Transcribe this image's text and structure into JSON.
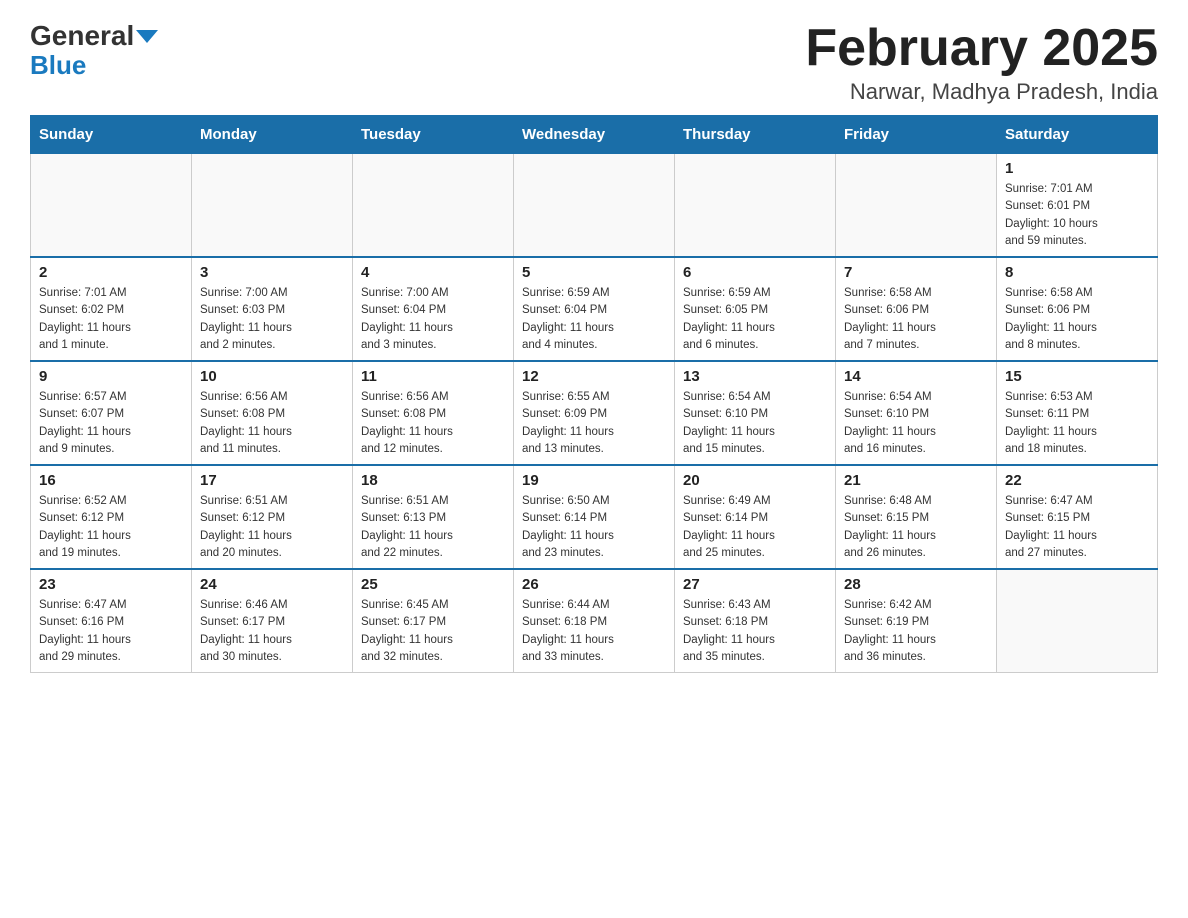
{
  "header": {
    "logo_general": "General",
    "logo_blue": "Blue",
    "title": "February 2025",
    "subtitle": "Narwar, Madhya Pradesh, India"
  },
  "weekdays": [
    "Sunday",
    "Monday",
    "Tuesday",
    "Wednesday",
    "Thursday",
    "Friday",
    "Saturday"
  ],
  "weeks": [
    [
      {
        "day": "",
        "info": ""
      },
      {
        "day": "",
        "info": ""
      },
      {
        "day": "",
        "info": ""
      },
      {
        "day": "",
        "info": ""
      },
      {
        "day": "",
        "info": ""
      },
      {
        "day": "",
        "info": ""
      },
      {
        "day": "1",
        "info": "Sunrise: 7:01 AM\nSunset: 6:01 PM\nDaylight: 10 hours\nand 59 minutes."
      }
    ],
    [
      {
        "day": "2",
        "info": "Sunrise: 7:01 AM\nSunset: 6:02 PM\nDaylight: 11 hours\nand 1 minute."
      },
      {
        "day": "3",
        "info": "Sunrise: 7:00 AM\nSunset: 6:03 PM\nDaylight: 11 hours\nand 2 minutes."
      },
      {
        "day": "4",
        "info": "Sunrise: 7:00 AM\nSunset: 6:04 PM\nDaylight: 11 hours\nand 3 minutes."
      },
      {
        "day": "5",
        "info": "Sunrise: 6:59 AM\nSunset: 6:04 PM\nDaylight: 11 hours\nand 4 minutes."
      },
      {
        "day": "6",
        "info": "Sunrise: 6:59 AM\nSunset: 6:05 PM\nDaylight: 11 hours\nand 6 minutes."
      },
      {
        "day": "7",
        "info": "Sunrise: 6:58 AM\nSunset: 6:06 PM\nDaylight: 11 hours\nand 7 minutes."
      },
      {
        "day": "8",
        "info": "Sunrise: 6:58 AM\nSunset: 6:06 PM\nDaylight: 11 hours\nand 8 minutes."
      }
    ],
    [
      {
        "day": "9",
        "info": "Sunrise: 6:57 AM\nSunset: 6:07 PM\nDaylight: 11 hours\nand 9 minutes."
      },
      {
        "day": "10",
        "info": "Sunrise: 6:56 AM\nSunset: 6:08 PM\nDaylight: 11 hours\nand 11 minutes."
      },
      {
        "day": "11",
        "info": "Sunrise: 6:56 AM\nSunset: 6:08 PM\nDaylight: 11 hours\nand 12 minutes."
      },
      {
        "day": "12",
        "info": "Sunrise: 6:55 AM\nSunset: 6:09 PM\nDaylight: 11 hours\nand 13 minutes."
      },
      {
        "day": "13",
        "info": "Sunrise: 6:54 AM\nSunset: 6:10 PM\nDaylight: 11 hours\nand 15 minutes."
      },
      {
        "day": "14",
        "info": "Sunrise: 6:54 AM\nSunset: 6:10 PM\nDaylight: 11 hours\nand 16 minutes."
      },
      {
        "day": "15",
        "info": "Sunrise: 6:53 AM\nSunset: 6:11 PM\nDaylight: 11 hours\nand 18 minutes."
      }
    ],
    [
      {
        "day": "16",
        "info": "Sunrise: 6:52 AM\nSunset: 6:12 PM\nDaylight: 11 hours\nand 19 minutes."
      },
      {
        "day": "17",
        "info": "Sunrise: 6:51 AM\nSunset: 6:12 PM\nDaylight: 11 hours\nand 20 minutes."
      },
      {
        "day": "18",
        "info": "Sunrise: 6:51 AM\nSunset: 6:13 PM\nDaylight: 11 hours\nand 22 minutes."
      },
      {
        "day": "19",
        "info": "Sunrise: 6:50 AM\nSunset: 6:14 PM\nDaylight: 11 hours\nand 23 minutes."
      },
      {
        "day": "20",
        "info": "Sunrise: 6:49 AM\nSunset: 6:14 PM\nDaylight: 11 hours\nand 25 minutes."
      },
      {
        "day": "21",
        "info": "Sunrise: 6:48 AM\nSunset: 6:15 PM\nDaylight: 11 hours\nand 26 minutes."
      },
      {
        "day": "22",
        "info": "Sunrise: 6:47 AM\nSunset: 6:15 PM\nDaylight: 11 hours\nand 27 minutes."
      }
    ],
    [
      {
        "day": "23",
        "info": "Sunrise: 6:47 AM\nSunset: 6:16 PM\nDaylight: 11 hours\nand 29 minutes."
      },
      {
        "day": "24",
        "info": "Sunrise: 6:46 AM\nSunset: 6:17 PM\nDaylight: 11 hours\nand 30 minutes."
      },
      {
        "day": "25",
        "info": "Sunrise: 6:45 AM\nSunset: 6:17 PM\nDaylight: 11 hours\nand 32 minutes."
      },
      {
        "day": "26",
        "info": "Sunrise: 6:44 AM\nSunset: 6:18 PM\nDaylight: 11 hours\nand 33 minutes."
      },
      {
        "day": "27",
        "info": "Sunrise: 6:43 AM\nSunset: 6:18 PM\nDaylight: 11 hours\nand 35 minutes."
      },
      {
        "day": "28",
        "info": "Sunrise: 6:42 AM\nSunset: 6:19 PM\nDaylight: 11 hours\nand 36 minutes."
      },
      {
        "day": "",
        "info": ""
      }
    ]
  ]
}
